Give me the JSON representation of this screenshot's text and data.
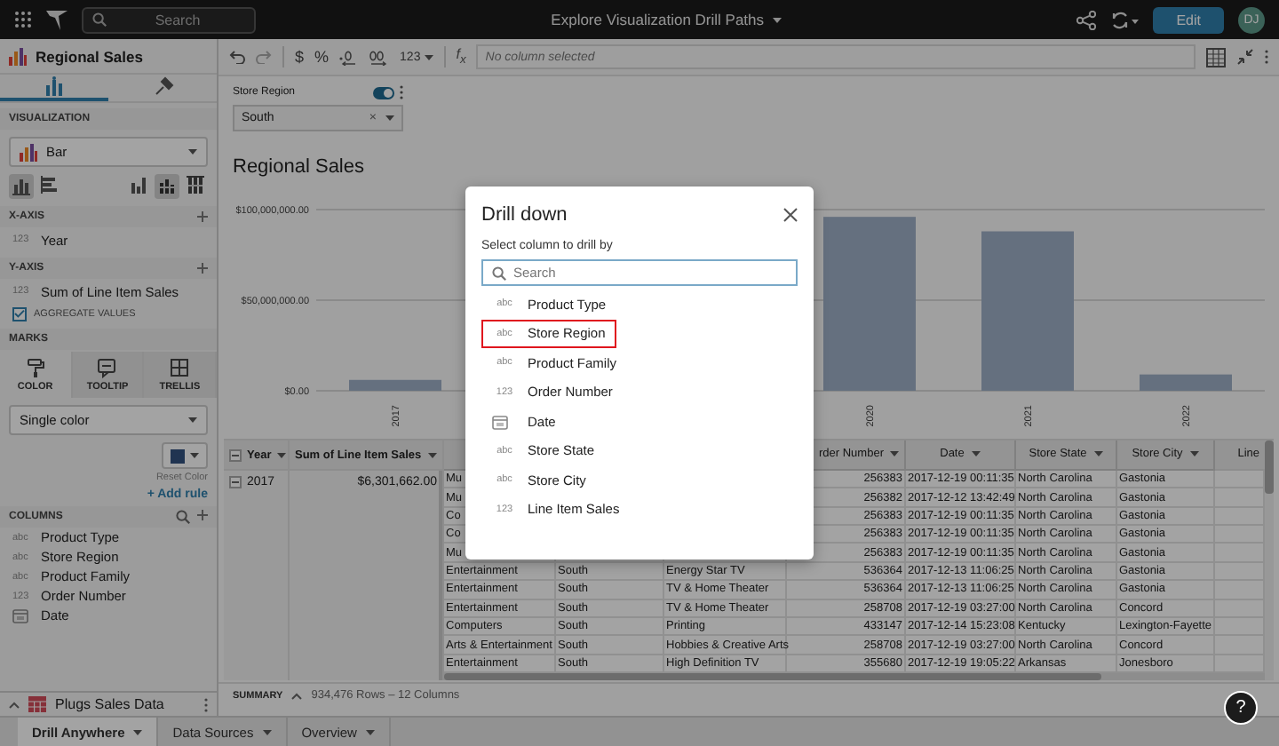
{
  "top_bar": {
    "search": {
      "placeholder": "Search"
    },
    "title": "Explore Visualization Drill Paths",
    "edit_button": "Edit",
    "avatar": "DJ"
  },
  "sidebar": {
    "title": "Regional Sales",
    "tabs": [
      {
        "kind": "data",
        "selected": true
      },
      {
        "kind": "format",
        "selected": false
      }
    ],
    "visualization": {
      "label": "VISUALIZATION",
      "type": "Bar",
      "chart_types": [
        {
          "kind": "column",
          "selected": true
        },
        {
          "kind": "horizontal",
          "selected": false
        },
        {
          "kind": "grouped",
          "selected": false
        },
        {
          "kind": "stacked",
          "selected": true
        },
        {
          "kind": "full",
          "selected": false
        }
      ]
    },
    "x_axis": {
      "label": "X-AXIS",
      "fields": [
        {
          "kind": "number",
          "type_label": "123",
          "name": "Year"
        }
      ]
    },
    "y_axis": {
      "label": "Y-AXIS",
      "fields": [
        {
          "kind": "number",
          "type_label": "123",
          "name": "Sum of Line Item Sales"
        }
      ],
      "aggregate": {
        "label": "AGGREGATE VALUES",
        "checked": true
      }
    },
    "marks": {
      "label": "MARKS",
      "tabs": [
        {
          "kind": "color",
          "label": "COLOR",
          "selected": true
        },
        {
          "kind": "tooltip",
          "label": "TOOLTIP",
          "selected": false
        },
        {
          "kind": "trellis",
          "label": "TRELLIS",
          "selected": false
        }
      ],
      "color_mode": "Single color",
      "reset": "Reset Color",
      "add_rule": "+ Add rule"
    },
    "columns": {
      "label": "COLUMNS",
      "items": [
        {
          "kind": "text",
          "type_label": "abc",
          "name": "Product Type"
        },
        {
          "kind": "text",
          "type_label": "abc",
          "name": "Store Region"
        },
        {
          "kind": "text",
          "type_label": "abc",
          "name": "Product Family"
        },
        {
          "kind": "number",
          "type_label": "123",
          "name": "Order Number"
        },
        {
          "kind": "date",
          "name": "Date"
        }
      ]
    },
    "source": {
      "name": "Plugs Sales Data"
    }
  },
  "toolbar": {
    "format_buttons": [
      "$",
      "%"
    ],
    "number_format": "123",
    "formula_label": "f$_{x}$",
    "formula_placeholder": "No column selected"
  },
  "filter": {
    "label": "Store Region",
    "enabled": true,
    "value": "South",
    "clear": "×"
  },
  "chart": {
    "title": "Regional Sales",
    "chart_data": {
      "type": "bar",
      "categories": [
        "2017",
        null,
        null,
        "2020",
        "2021",
        "2022"
      ],
      "values": [
        6000000,
        null,
        null,
        96000000,
        88000000,
        9000000
      ],
      "ylim": [
        0,
        100000000
      ],
      "yticks": [
        {
          "value": 0,
          "label": "$0.00"
        },
        {
          "value": 50000000,
          "label": "$50,000,000.00"
        },
        {
          "value": 100000000,
          "label": "$100,000,000.00"
        }
      ]
    }
  },
  "table": {
    "pivot_columns": [
      "Year",
      "Sum of Line Item Sales"
    ],
    "pivot_row": {
      "year": "2017",
      "sum": "$6,301,662.00",
      "expanded": true
    },
    "columns": [
      {},
      {},
      {},
      {
        "label": "rder Number",
        "menu": true
      },
      {
        "label": "Date",
        "menu": true
      },
      {
        "label": "Store State",
        "menu": true
      },
      {
        "label": "Store City",
        "menu": true
      },
      {
        "label": "Line",
        "menu": false
      }
    ],
    "rows": [
      [
        "Mu",
        null,
        null,
        "256383",
        "2017-12-19 00:11:35",
        "North Carolina",
        "Gastonia"
      ],
      [
        "Mu",
        null,
        null,
        "256382",
        "2017-12-12 13:42:49",
        "North Carolina",
        "Gastonia"
      ],
      [
        "Co",
        null,
        null,
        "256383",
        "2017-12-19 00:11:35",
        "North Carolina",
        "Gastonia"
      ],
      [
        "Co",
        null,
        null,
        "256383",
        "2017-12-19 00:11:35",
        "North Carolina",
        "Gastonia"
      ],
      [
        "Mu",
        null,
        null,
        "256383",
        "2017-12-19 00:11:35",
        "North Carolina",
        "Gastonia"
      ],
      [
        "Entertainment",
        "South",
        "Energy Star TV",
        "536364",
        "2017-12-13 11:06:25",
        "North Carolina",
        "Gastonia"
      ],
      [
        "Entertainment",
        "South",
        "TV & Home Theater",
        "536364",
        "2017-12-13 11:06:25",
        "North Carolina",
        "Gastonia"
      ],
      [
        "Entertainment",
        "South",
        "TV & Home Theater",
        "258708",
        "2017-12-19 03:27:00",
        "North Carolina",
        "Concord"
      ],
      [
        "Computers",
        "South",
        "Printing",
        "433147",
        "2017-12-14 15:23:08",
        "Kentucky",
        "Lexington-Fayette"
      ],
      [
        "Arts & Entertainment",
        "South",
        "Hobbies & Creative Arts",
        "258708",
        "2017-12-19 03:27:00",
        "North Carolina",
        "Concord"
      ],
      [
        "Entertainment",
        "South",
        "High Definition TV",
        "355680",
        "2017-12-19 19:05:22",
        "Arkansas",
        "Jonesboro"
      ]
    ]
  },
  "summary": {
    "label": "SUMMARY",
    "text": "934,476 Rows – 12 Columns"
  },
  "bottom_tabs": [
    {
      "label": "Drill Anywhere",
      "selected": true
    },
    {
      "label": "Data Sources",
      "selected": false
    },
    {
      "label": "Overview",
      "selected": false
    }
  ],
  "help": "?",
  "modal": {
    "title": "Drill down",
    "subtitle": "Select column to drill by",
    "search": {
      "placeholder": "Search"
    },
    "items": [
      {
        "kind": "text",
        "type_label": "abc",
        "name": "Product Type",
        "selected": false
      },
      {
        "kind": "text",
        "type_label": "abc",
        "name": "Store Region",
        "selected": true
      },
      {
        "kind": "text",
        "type_label": "abc",
        "name": "Product Family",
        "selected": false
      },
      {
        "kind": "number",
        "type_label": "123",
        "name": "Order Number",
        "selected": false
      },
      {
        "kind": "date",
        "name": "Date",
        "selected": false
      },
      {
        "kind": "text",
        "type_label": "abc",
        "name": "Store State",
        "selected": false
      },
      {
        "kind": "text",
        "type_label": "abc",
        "name": "Store City",
        "selected": false
      },
      {
        "kind": "number",
        "type_label": "123",
        "name": "Line Item Sales",
        "selected": false
      }
    ]
  }
}
